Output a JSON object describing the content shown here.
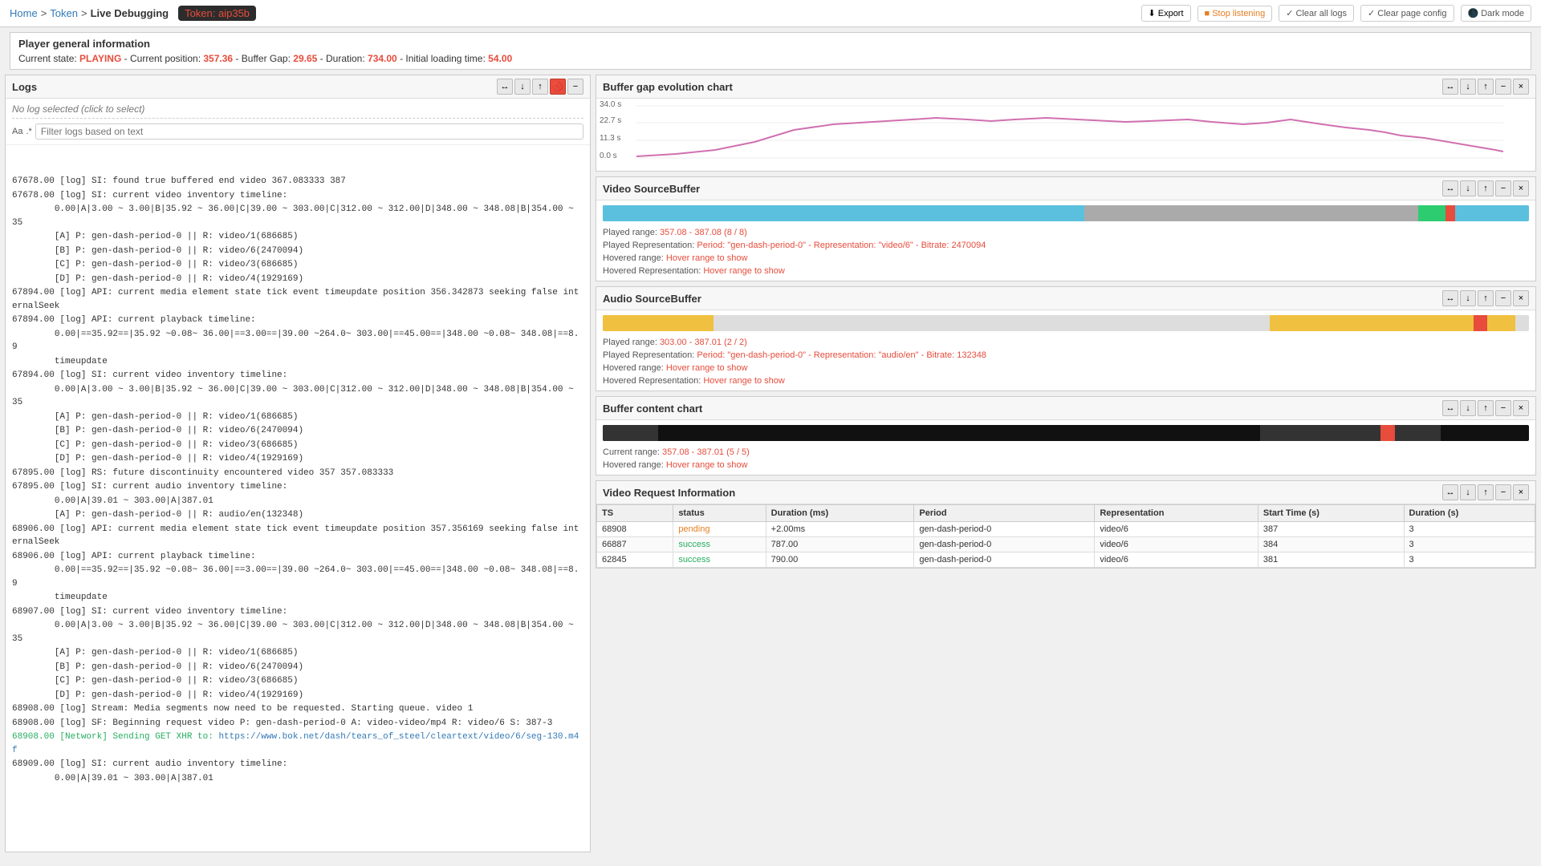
{
  "breadcrumb": {
    "home": "Home",
    "token": "Token",
    "live": "Live Debugging",
    "token_value": "Token: aip35b"
  },
  "toolbar": {
    "export": "Export",
    "stop_listening": "Stop listening",
    "clear_all_logs": "Clear all logs",
    "clear_page_config": "Clear page config",
    "dark_mode": "Dark mode"
  },
  "player": {
    "title": "Player general information",
    "state_label": "Current state:",
    "state_value": "PLAYING",
    "position_label": "Current position:",
    "position_value": "357.36",
    "buffer_gap_label": "Buffer Gap:",
    "buffer_gap_value": "29.65",
    "duration_label": "Duration:",
    "duration_value": "734.00",
    "loading_label": "Initial loading time:",
    "loading_value": "54.00"
  },
  "logs_panel": {
    "title": "Logs",
    "no_log": "No log selected (click to select)",
    "filter_placeholder": "Filter logs based on text",
    "content": [
      "67678.00 [log] SI: found true buffered end video 367.083333 387",
      "67678.00 [log] SI: current video inventory timeline:",
      "        0.00|A|3.00 ~ 3.00|B|35.92 ~ 36.00|C|39.00 ~ 303.00|C|312.00 ~ 312.00|D|348.00 ~ 348.08|B|354.00 ~ 35",
      "        [A] P: gen-dash-period-0 || R: video/1(686685)",
      "        [B] P: gen-dash-period-0 || R: video/6(2470094)",
      "        [C] P: gen-dash-period-0 || R: video/3(686685)",
      "        [D] P: gen-dash-period-0 || R: video/4(1929169)",
      "",
      "67894.00 [log] API: current media element state tick event timeupdate position 356.342873 seeking false internalSeek",
      "67894.00 [log] API: current playback timeline:",
      "        0.00|==35.92==|35.92 ~0.08~ 36.00|==3.00==|39.00 ~264.0~ 303.00|==45.00==|348.00 ~0.08~ 348.08|==8.9",
      "        timeupdate",
      "",
      "67894.00 [log] SI: current video inventory timeline:",
      "        0.00|A|3.00 ~ 3.00|B|35.92 ~ 36.00|C|39.00 ~ 303.00|C|312.00 ~ 312.00|D|348.00 ~ 348.08|B|354.00 ~ 35",
      "        [A] P: gen-dash-period-0 || R: video/1(686685)",
      "        [B] P: gen-dash-period-0 || R: video/6(2470094)",
      "        [C] P: gen-dash-period-0 || R: video/3(686685)",
      "        [D] P: gen-dash-period-0 || R: video/4(1929169)",
      "",
      "67895.00 [log] RS: future discontinuity encountered video 357 357.083333",
      "",
      "67895.00 [log] SI: current audio inventory timeline:",
      "        0.00|A|39.01 ~ 303.00|A|387.01",
      "        [A] P: gen-dash-period-0 || R: audio/en(132348)",
      "",
      "68906.00 [log] API: current media element state tick event timeupdate position 357.356169 seeking false internalSeek",
      "68906.00 [log] API: current playback timeline:",
      "        0.00|==35.92==|35.92 ~0.08~ 36.00|==3.00==|39.00 ~264.0~ 303.00|==45.00==|348.00 ~0.08~ 348.08|==8.9",
      "        timeupdate",
      "",
      "68907.00 [log] SI: current video inventory timeline:",
      "        0.00|A|3.00 ~ 3.00|B|35.92 ~ 36.00|C|39.00 ~ 303.00|C|312.00 ~ 312.00|D|348.00 ~ 348.08|B|354.00 ~ 35",
      "        [A] P: gen-dash-period-0 || R: video/1(686685)",
      "        [B] P: gen-dash-period-0 || R: video/6(2470094)",
      "        [C] P: gen-dash-period-0 || R: video/3(686685)",
      "        [D] P: gen-dash-period-0 || R: video/4(1929169)",
      "",
      "68908.00 [log] Stream: Media segments now need to be requested. Starting queue. video 1",
      "68908.00 [log] SF: Beginning request video P: gen-dash-period-0 A: video-video/mp4 R: video/6 S: 387-3",
      "68908.00 [Network] Sending GET XHR to: https://www.bok.net/dash/tears_of_steel/cleartext/video/6/seg-130.m4f",
      "68909.00 [log] SI: current audio inventory timeline:",
      "        0.00|A|39.01 ~ 303.00|A|387.01"
    ]
  },
  "buffer_gap_chart": {
    "title": "Buffer gap evolution chart",
    "y_labels": [
      "34.0 s",
      "22.7 s",
      "11.3 s",
      "0.0 s"
    ]
  },
  "video_source_buffer": {
    "title": "Video SourceBuffer",
    "played_range": "357.08 - 387.08 (8 / 8)",
    "played_rep": "Period: \"gen-dash-period-0\" - Representation: \"video/6\" - Bitrate: 2470094",
    "hovered_range": "Hover range to show",
    "hovered_rep": "Hover range to show"
  },
  "audio_source_buffer": {
    "title": "Audio SourceBuffer",
    "played_range": "303.00 - 387.01 (2 / 2)",
    "played_rep": "Period: \"gen-dash-period-0\" - Representation: \"audio/en\" - Bitrate: 132348",
    "hovered_range": "Hover range to show",
    "hovered_rep": "Hover range to show"
  },
  "buffer_content_chart": {
    "title": "Buffer content chart",
    "current_range": "357.08 - 387.01 (5 / 5)",
    "hovered_range": "Hover range to show"
  },
  "video_request_info": {
    "title": "Video Request Information",
    "columns": [
      "TS",
      "status",
      "Duration (ms)",
      "Period",
      "Representation",
      "Start Time (s)",
      "Duration (s)"
    ],
    "rows": [
      {
        "ts": "68908",
        "status": "pending",
        "status_type": "pending",
        "duration_ms": "+2.00ms",
        "period": "gen-dash-period-0",
        "representation": "video/6",
        "start_time": "387",
        "duration_s": "3"
      },
      {
        "ts": "66887",
        "status": "success",
        "status_type": "success",
        "duration_ms": "787.00",
        "period": "gen-dash-period-0",
        "representation": "video/6",
        "start_time": "384",
        "duration_s": "3"
      },
      {
        "ts": "62845",
        "status": "success",
        "status_type": "success",
        "duration_ms": "790.00",
        "period": "gen-dash-period-0",
        "representation": "video/6",
        "start_time": "381",
        "duration_s": "3"
      }
    ]
  },
  "icons": {
    "export": "⬇",
    "stop": "⬛",
    "clear": "✓",
    "dark": "🌑",
    "expand": "↔",
    "down": "↓",
    "up": "↑",
    "minus": "−",
    "close": "×",
    "arrow_left": "←",
    "arrow_right": "→",
    "no_clear": "🚫"
  }
}
